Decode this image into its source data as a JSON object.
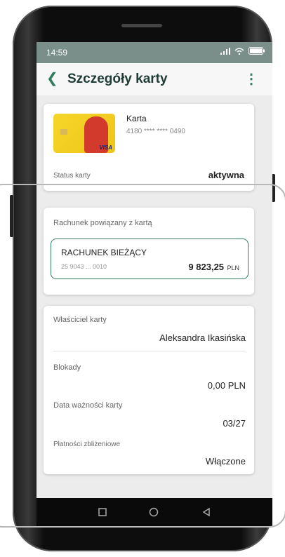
{
  "status_bar": {
    "time": "14:59"
  },
  "header": {
    "title": "Szczegóły karty"
  },
  "card": {
    "type_label": "Karta",
    "number": "4180 **** **** 0490",
    "brand": "VISA",
    "status_label": "Status karty",
    "status_value": "aktywna"
  },
  "account": {
    "section_label": "Rachunek powiązany z kartą",
    "name": "RACHUNEK BIEŻĄCY",
    "number": "25 9043 ... 0010",
    "balance": "9 823,25",
    "currency": "PLN"
  },
  "details": [
    {
      "label": "Właściciel karty",
      "value": "Aleksandra Ikasińska"
    },
    {
      "label": "Blokady",
      "value": "0,00 PLN"
    },
    {
      "label": "Data ważności karty",
      "value": "03/27"
    },
    {
      "label": "Płatności zbliżeniowe",
      "value": "Włączone"
    }
  ],
  "colors": {
    "accent": "#2f7d5b",
    "status_bar": "#7a8f8a",
    "screen_bg": "#ececec"
  }
}
